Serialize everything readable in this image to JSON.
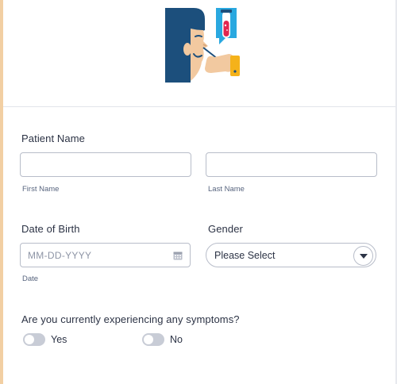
{
  "form": {
    "patient_name": {
      "label": "Patient Name",
      "first_sublabel": "First Name",
      "last_sublabel": "Last Name",
      "first_value": "",
      "last_value": ""
    },
    "dob": {
      "label": "Date of Birth",
      "placeholder": "MM-DD-YYYY",
      "sublabel": "Date",
      "icon": "calendar-icon"
    },
    "gender": {
      "label": "Gender",
      "selected": "Please Select",
      "icon": "chevron-down-icon"
    },
    "symptoms": {
      "question": "Are you currently experiencing any symptoms?",
      "options": [
        {
          "label": "Yes",
          "on": false
        },
        {
          "label": "No",
          "on": false
        }
      ]
    }
  },
  "colors": {
    "accent_strip": "#f2cfa3",
    "text": "#2c3345",
    "border": "#b8bdc9",
    "toggle_off": "#c8ccd6",
    "illustration_hair": "#1c4f7c",
    "illustration_skin": "#f2c9a0",
    "illustration_card": "#29a8e0",
    "illustration_tube": "#e2264f",
    "illustration_yellow": "#f5b21a"
  }
}
